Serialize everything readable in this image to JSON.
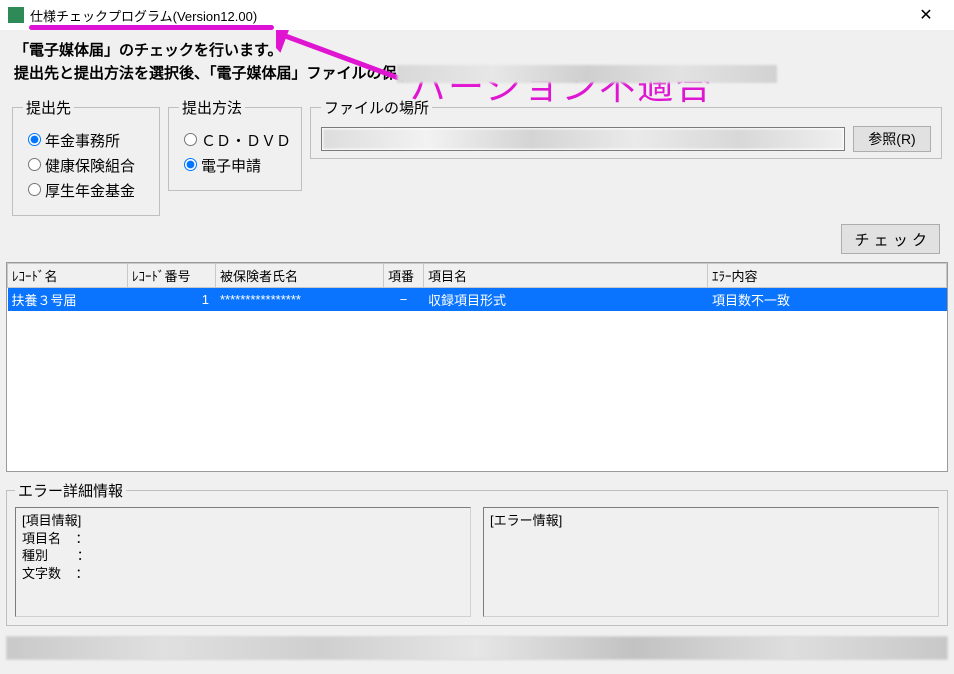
{
  "window": {
    "title": "仕様チェックプログラム(Version12.00)",
    "close_glyph": "✕"
  },
  "annotation": {
    "text": "バージョン不適合"
  },
  "instructions": {
    "line1": "「電子媒体届」のチェックを行います。",
    "line2_prefix": "提出先と提出方法を選択後、「電子媒体届」ファイルの保"
  },
  "groups": {
    "destination": {
      "legend": "提出先",
      "opt1": "年金事務所",
      "opt2": "健康保険組合",
      "opt3": "厚生年金基金"
    },
    "method": {
      "legend": "提出方法",
      "opt1": "ＣＤ・ＤＶＤ",
      "opt2": "電子申請"
    },
    "file": {
      "legend": "ファイルの場所",
      "browse_label": "参照(R)"
    }
  },
  "check_button": "チ ェ ッ ク",
  "table": {
    "headers": {
      "rec_name": "ﾚｺｰﾄﾞ名",
      "rec_no": "ﾚｺｰﾄﾞ番号",
      "insured_name": "被保険者氏名",
      "item_no": "項番",
      "item_name": "項目名",
      "err": "ｴﾗｰ内容"
    },
    "row": {
      "rec_name": "扶養３号届",
      "rec_no": "1",
      "insured_name": "****************",
      "item_no": "−",
      "item_name": "収録項目形式",
      "err": "項目数不一致"
    }
  },
  "error_detail": {
    "legend": "エラー詳細情報",
    "left_text": "[項目情報]\n項目名    ：\n種別        ：\n文字数    ：",
    "right_text": "[エラー情報]"
  }
}
